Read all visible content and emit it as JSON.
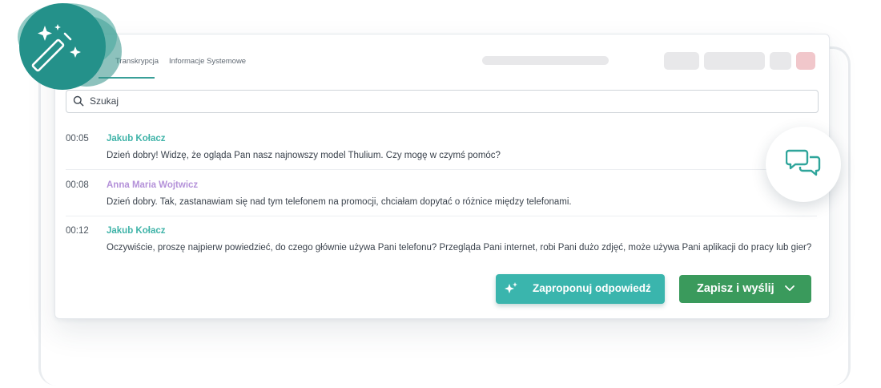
{
  "tabs": [
    {
      "label": "Transkrypcja"
    },
    {
      "label": "Informacje Systemowe"
    }
  ],
  "search": {
    "placeholder": "Szukaj"
  },
  "transcript": [
    {
      "time": "00:05",
      "speaker": "Jakub Kołacz",
      "message": "Dzień dobry! Widzę, że ogląda Pan nasz najnowszy model Thulium. Czy mogę w czymś pomóc?"
    },
    {
      "time": "00:08",
      "speaker": "Anna Maria Wojtwicz",
      "message": "Dzień dobry. Tak, zastanawiam się nad tym telefonem na promocji, chciałam dopytać o różnice między telefonami."
    },
    {
      "time": "00:12",
      "speaker": "Jakub Kołacz",
      "message": "Oczywiście, proszę najpierw powiedzieć, do czego głównie używa Pani telefonu? Przegląda Pani internet, robi Pani dużo zdjęć, może używa Pani aplikacji do pracy lub gier?"
    }
  ],
  "actions": {
    "suggest_label": "Zaproponuj odpowiedź",
    "save_label": "Zapisz i wyślij"
  },
  "colors": {
    "accent": "#3ab5ad",
    "save": "#3a9a5c",
    "agent_name": "#3fb3a8",
    "customer_name": "#b491d9"
  },
  "icons": {
    "badge": "magic-wand-icon",
    "float": "chat-bubbles-icon",
    "search": "search-icon",
    "suggest": "sparkle-icon",
    "dropdown": "chevron-down-icon"
  }
}
